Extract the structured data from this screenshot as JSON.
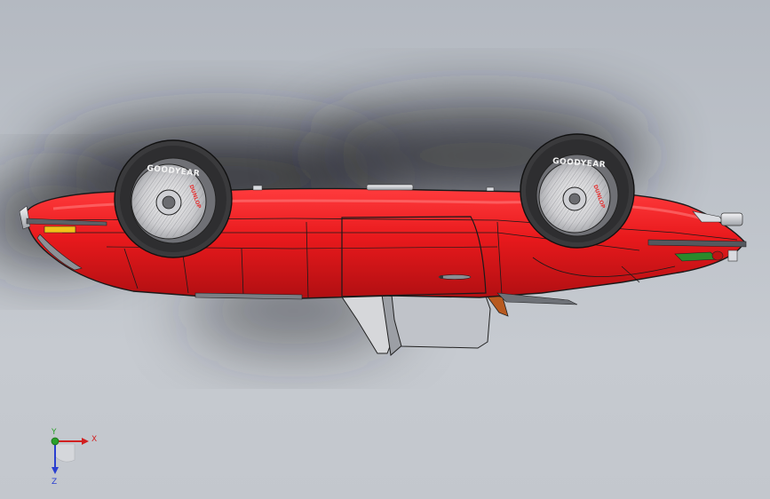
{
  "viewport": {
    "background_top": "#b4b9c1",
    "background_bottom": "#c6cad0",
    "shadow_color": "#1c1d22"
  },
  "model": {
    "subject": "car-body-upside-down",
    "body_color": "#e8191c",
    "body_shade": "#b00f12",
    "outline_color": "#1a1a1a",
    "chrome_color": "#d9dbe0",
    "tire_color": "#3a3a3c",
    "tire_sidewall_text": "GOODYEAR",
    "wheel_rim_brand_text": "DUNLOP"
  },
  "triad": {
    "x_label": "X",
    "y_label": "Y",
    "z_label": "Z",
    "x_color": "#d12020",
    "y_color": "#2aa02a",
    "z_color": "#2a3fd0"
  }
}
